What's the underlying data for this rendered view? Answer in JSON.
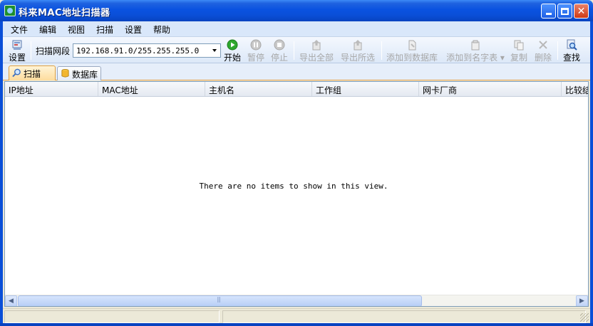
{
  "window": {
    "title": "科来MAC地址扫描器"
  },
  "menu": [
    "文件",
    "编辑",
    "视图",
    "扫描",
    "设置",
    "帮助"
  ],
  "toolbar": {
    "settings_label": "设置",
    "range_label": "扫描网段",
    "range_value": "192.168.91.0/255.255.255.0",
    "start_label": "开始",
    "pause_label": "暂停",
    "stop_label": "停止",
    "export_all_label": "导出全部",
    "export_selected_label": "导出所选",
    "add_to_db_label": "添加到数据库",
    "add_to_names_label": "添加到名字表",
    "copy_label": "复制",
    "delete_label": "删除",
    "find_label": "查找"
  },
  "tabs": {
    "scan": "扫描",
    "database": "数据库"
  },
  "list": {
    "columns": [
      "IP地址",
      "MAC地址",
      "主机名",
      "工作组",
      "网卡厂商",
      "比较结"
    ],
    "empty_text": "There are no items to show in this view."
  },
  "colors": {
    "title_bar": "#0a52e0",
    "start_icon": "#2ea82e",
    "active_tab": "#fddc9d"
  }
}
